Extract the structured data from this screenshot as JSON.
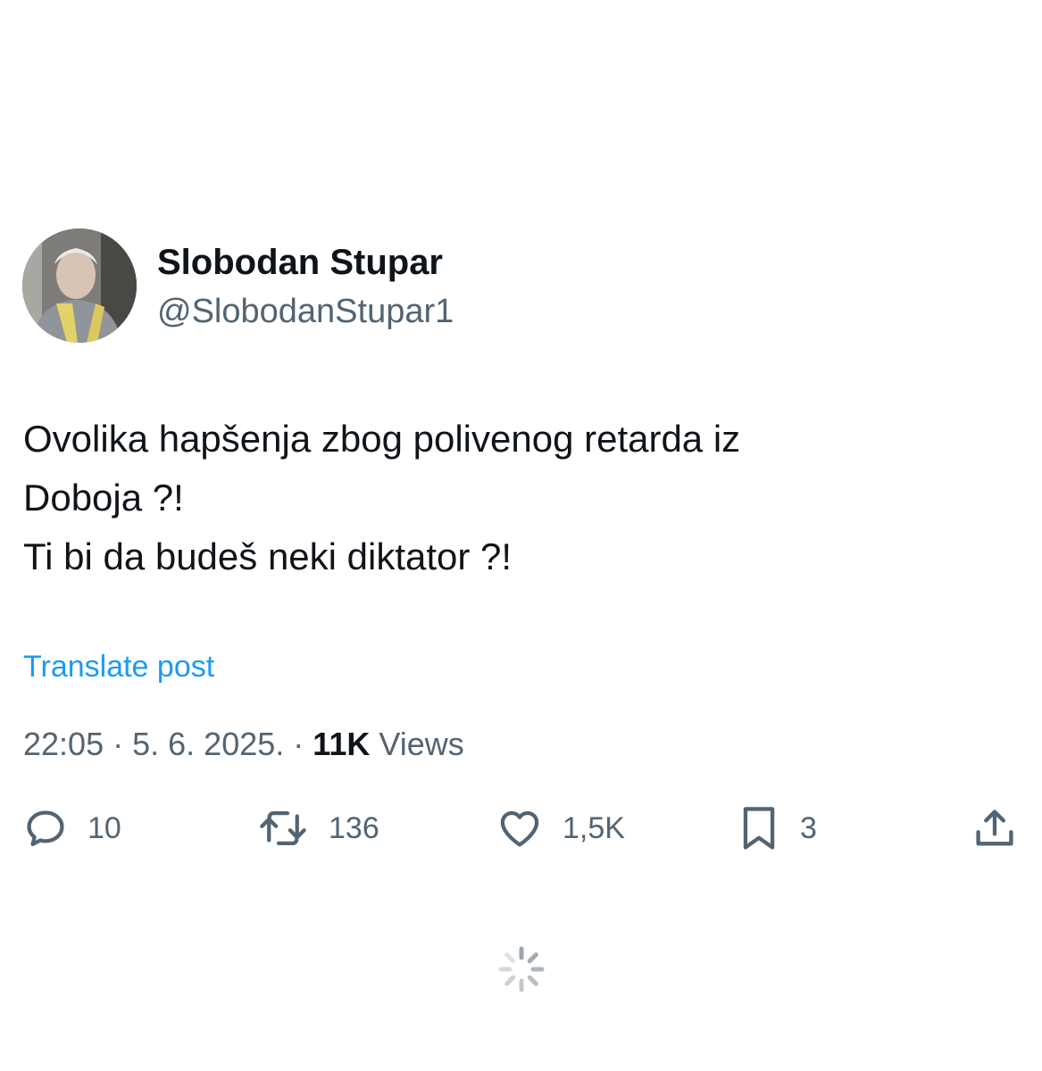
{
  "author": {
    "display_name": "Slobodan Stupar",
    "handle": "@SlobodanStupar1"
  },
  "tweet": {
    "lines": [
      "Ovolika hapšenja zbog polivenog retarda iz",
      "Doboja ?!",
      "Ti bi da budeš neki diktator ?!"
    ],
    "translate_label": "Translate post",
    "time": "22:05",
    "date": "5. 6. 2025.",
    "separator": "·",
    "views_count": "11K",
    "views_label": "Views"
  },
  "actions": {
    "reply": {
      "icon": "reply-icon",
      "count": "10"
    },
    "retweet": {
      "icon": "retweet-icon",
      "count": "136"
    },
    "like": {
      "icon": "heart-icon",
      "count": "1,5K"
    },
    "bookmark": {
      "icon": "bookmark-icon",
      "count": "3"
    },
    "share": {
      "icon": "share-icon"
    }
  },
  "colors": {
    "text_primary": "#0f1419",
    "text_secondary": "#536471",
    "link": "#1d9bf0",
    "spinner": "#9aa4ad"
  }
}
